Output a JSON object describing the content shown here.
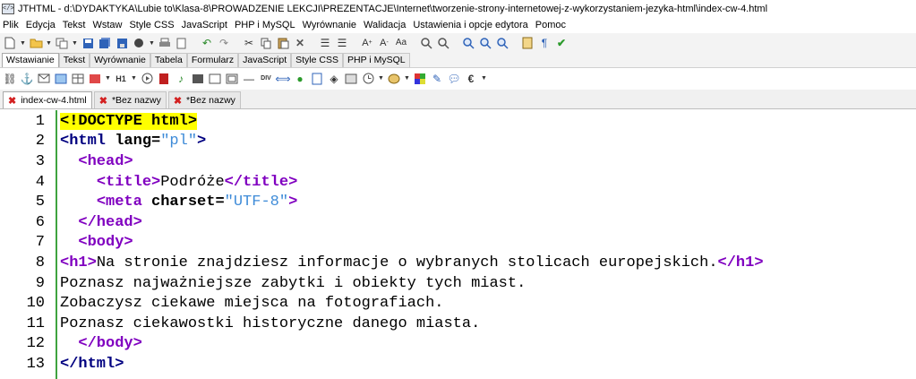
{
  "window": {
    "title": "JTHTML - d:\\DYDAKTYKA\\Lubie to\\Klasa-8\\PROWADZENIE LEKCJI\\PREZENTACJE\\Internet\\tworzenie-strony-internetowej-z-wykorzystaniem-jezyka-html\\index-cw-4.html"
  },
  "menu": {
    "items": [
      "Plik",
      "Edycja",
      "Tekst",
      "Wstaw",
      "Style CSS",
      "JavaScript",
      "PHP i MySQL",
      "Wyrównanie",
      "Walidacja",
      "Ustawienia i opcje edytora",
      "Pomoc"
    ]
  },
  "toolbar_tabs": {
    "items": [
      "Wstawianie",
      "Tekst",
      "Wyrównanie",
      "Tabela",
      "Formularz",
      "JavaScript",
      "Style CSS",
      "PHP i MySQL"
    ],
    "active": "Wstawianie"
  },
  "toolbar2": {
    "h1_label": "H1",
    "div_label": "DIV",
    "euro_label": "€"
  },
  "doc_tabs": {
    "items": [
      {
        "label": "index-cw-4.html",
        "active": true
      },
      {
        "label": "*Bez nazwy",
        "active": false
      },
      {
        "label": "*Bez nazwy",
        "active": false
      }
    ]
  },
  "editor": {
    "line_numbers": [
      "1",
      "2",
      "3",
      "4",
      "5",
      "6",
      "7",
      "8",
      "9",
      "10",
      "11",
      "12",
      "13"
    ],
    "lines": {
      "l1": {
        "doctype": "<!DOCTYPE html>"
      },
      "l2": {
        "open": "<html",
        "attr": " lang=",
        "val": "\"pl\"",
        "close": ">"
      },
      "l3": {
        "indent": "  ",
        "tag": "<head>"
      },
      "l4": {
        "indent": "    ",
        "open": "<title>",
        "text": "Podróże",
        "close": "</title>"
      },
      "l5": {
        "indent": "    ",
        "open": "<meta",
        "attr": " charset=",
        "val": "\"UTF-8\"",
        "close": ">"
      },
      "l6": {
        "indent": "  ",
        "tag": "</head>"
      },
      "l7": {
        "indent": "  ",
        "tag": "<body>"
      },
      "l8": {
        "open": "<h1>",
        "text": "Na stronie znajdziesz informacje o wybranych stolicach europejskich.",
        "close": "</h1>"
      },
      "l9": {
        "text": "Poznasz najważniejsze zabytki i obiekty tych miast."
      },
      "l10": {
        "text": "Zobaczysz ciekawe miejsca na fotografiach."
      },
      "l11": {
        "text": "Poznasz ciekawostki historyczne danego miasta."
      },
      "l12": {
        "indent": "  ",
        "tag": "</body>"
      },
      "l13": {
        "tag": "</html>"
      }
    }
  },
  "colors": {
    "tag": "#000080",
    "tag_purple": "#8000c0",
    "value": "#3e8bd8",
    "doctype_highlight": "#ffff00",
    "gutter_line": "#3fa33f",
    "close_icon": "#d32020"
  }
}
